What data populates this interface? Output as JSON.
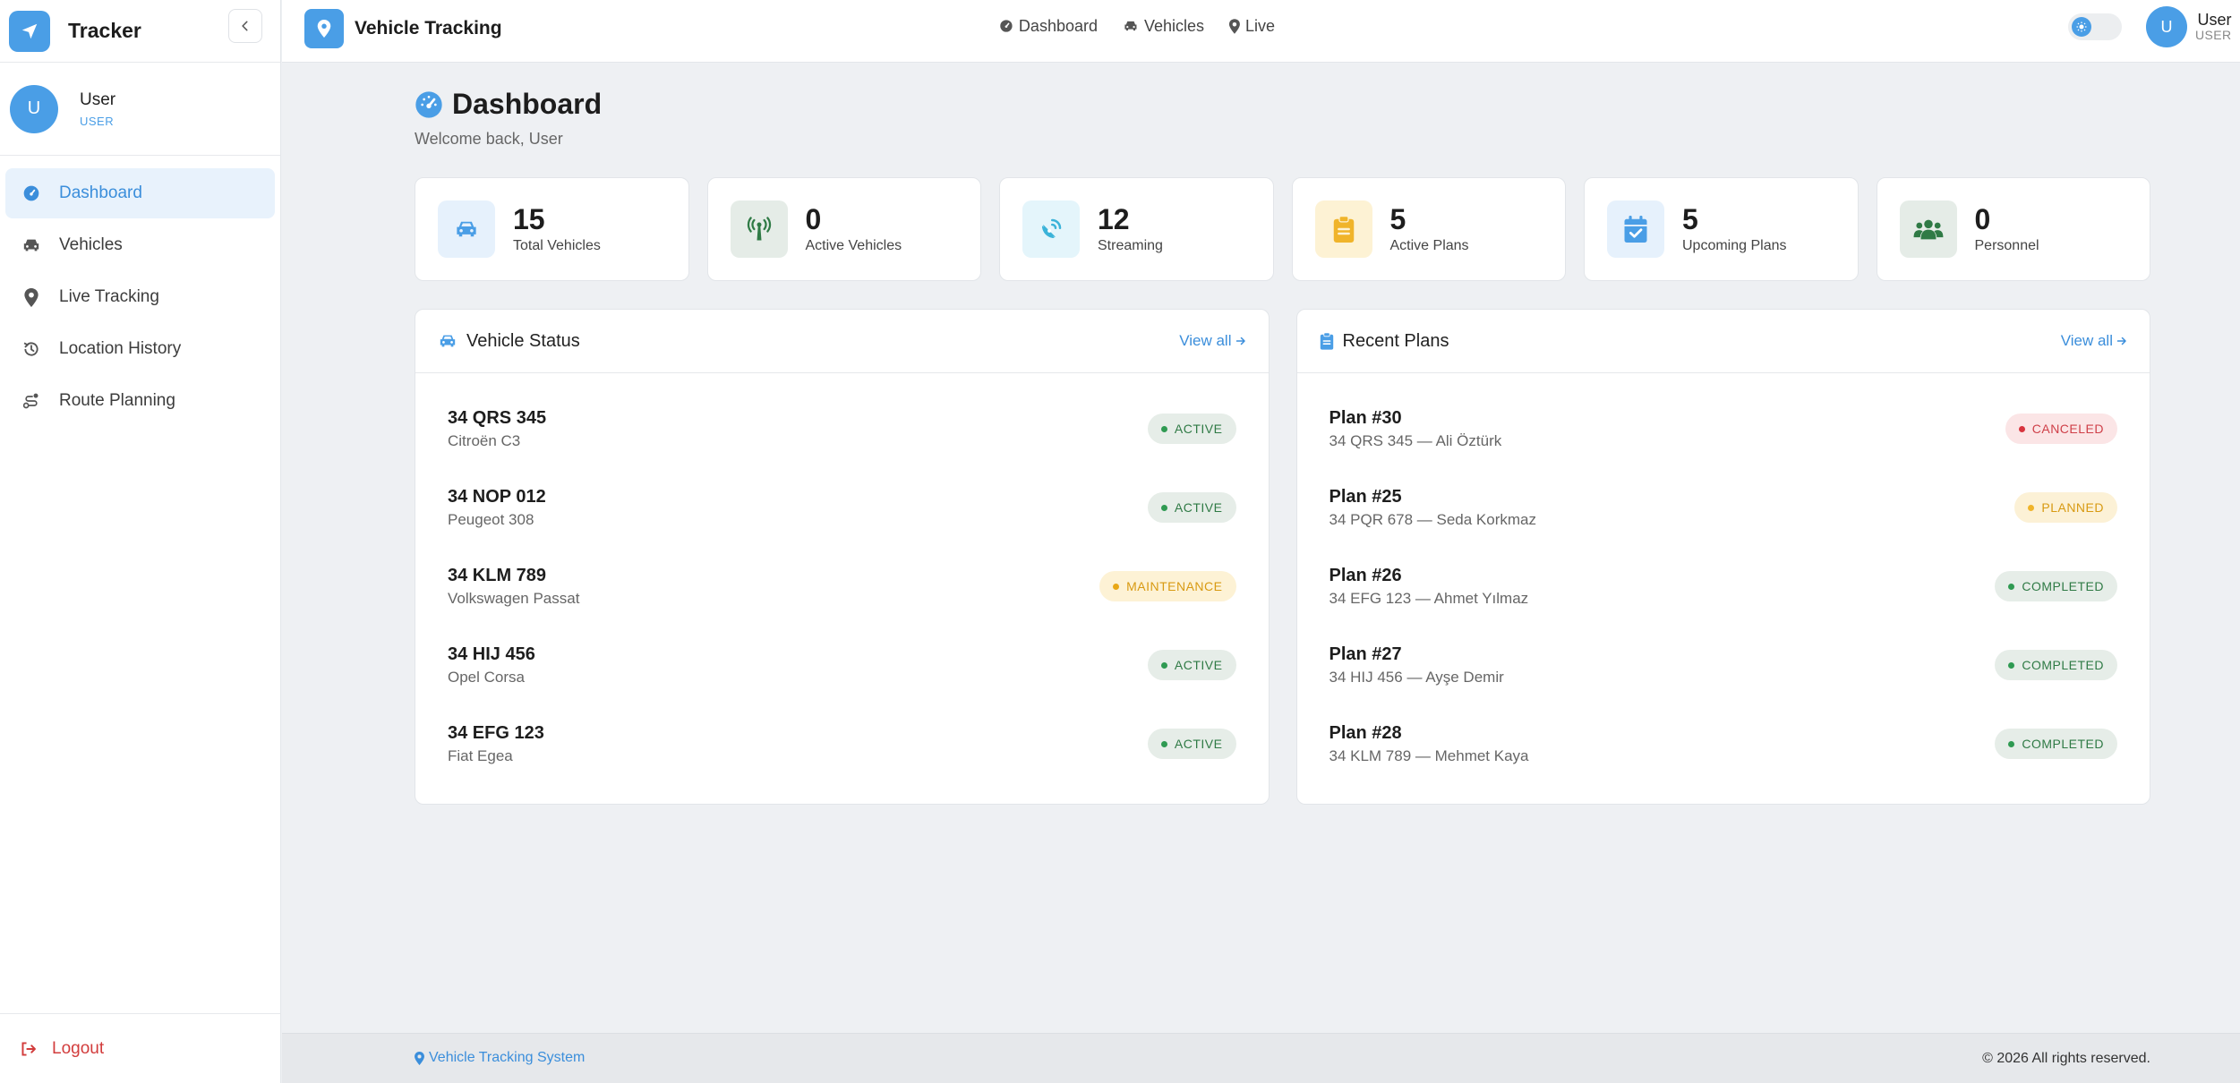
{
  "sidebar": {
    "brand": "Tracker",
    "user": {
      "initial": "U",
      "name": "User",
      "role": "USER"
    },
    "items": [
      {
        "label": "Dashboard"
      },
      {
        "label": "Vehicles"
      },
      {
        "label": "Live Tracking"
      },
      {
        "label": "Location History"
      },
      {
        "label": "Route Planning"
      }
    ],
    "logout": "Logout"
  },
  "topbar": {
    "title": "Vehicle Tracking",
    "nav": [
      {
        "label": "Dashboard"
      },
      {
        "label": "Vehicles"
      },
      {
        "label": "Live"
      }
    ],
    "user": {
      "initial": "U",
      "name": "User",
      "role": "USER"
    }
  },
  "page": {
    "title": "Dashboard",
    "subtitle": "Welcome back, User"
  },
  "stats": [
    {
      "value": "15",
      "label": "Total Vehicles"
    },
    {
      "value": "0",
      "label": "Active Vehicles"
    },
    {
      "value": "12",
      "label": "Streaming"
    },
    {
      "value": "5",
      "label": "Active Plans"
    },
    {
      "value": "5",
      "label": "Upcoming Plans"
    },
    {
      "value": "0",
      "label": "Personnel"
    }
  ],
  "vehicle_status": {
    "title": "Vehicle Status",
    "view_all": "View all",
    "rows": [
      {
        "plate": "34 QRS 345",
        "model": "Citroën C3",
        "status": "ACTIVE"
      },
      {
        "plate": "34 NOP 012",
        "model": "Peugeot 308",
        "status": "ACTIVE"
      },
      {
        "plate": "34 KLM 789",
        "model": "Volkswagen Passat",
        "status": "MAINTENANCE"
      },
      {
        "plate": "34 HIJ 456",
        "model": "Opel Corsa",
        "status": "ACTIVE"
      },
      {
        "plate": "34 EFG 123",
        "model": "Fiat Egea",
        "status": "ACTIVE"
      }
    ]
  },
  "recent_plans": {
    "title": "Recent Plans",
    "view_all": "View all",
    "rows": [
      {
        "plan": "Plan #30",
        "detail": "34 QRS 345 — Ali Öztürk",
        "status": "CANCELED"
      },
      {
        "plan": "Plan #25",
        "detail": "34 PQR 678 — Seda Korkmaz",
        "status": "PLANNED"
      },
      {
        "plan": "Plan #26",
        "detail": "34 EFG 123 — Ahmet Yılmaz",
        "status": "COMPLETED"
      },
      {
        "plan": "Plan #27",
        "detail": "34 HIJ 456 — Ayşe Demir",
        "status": "COMPLETED"
      },
      {
        "plan": "Plan #28",
        "detail": "34 KLM 789 — Mehmet Kaya",
        "status": "COMPLETED"
      }
    ]
  },
  "footer": {
    "left": "Vehicle Tracking System",
    "right": "© 2026 All rights reserved."
  },
  "colors": {
    "accent": "#4a9ee6",
    "danger": "#d23c3c",
    "success": "#2f7a45",
    "warning": "#d89a12"
  },
  "icons": {
    "brand": "navigation-arrow-icon",
    "collapse": "chevron-left-icon",
    "nav": [
      "gauge-icon",
      "car-icon",
      "map-pin-icon",
      "history-icon",
      "route-icon"
    ],
    "logout": "sign-out-icon",
    "stats": [
      "car-icon",
      "antenna-icon",
      "satellite-dish-icon",
      "clipboard-icon",
      "calendar-check-icon",
      "users-icon"
    ]
  }
}
